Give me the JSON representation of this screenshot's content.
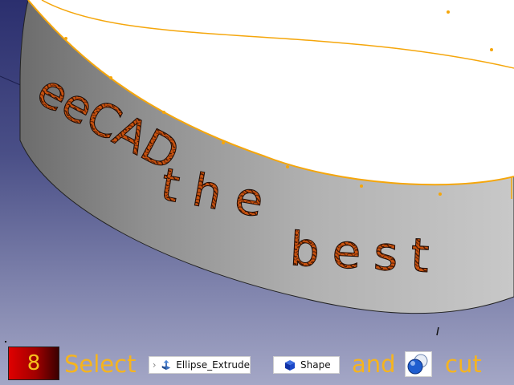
{
  "viewport": {
    "engraved_text": [
      "eeCAD",
      "the",
      "best"
    ]
  },
  "tutorial": {
    "step_number": "8",
    "select_label": "Select",
    "item1_label": "Ellipse_Extrude",
    "item2_label": "Shape",
    "and_label": "and",
    "cut_label": "cut"
  },
  "icons": {
    "item1": "extrude-icon",
    "item2": "shape-cube-icon",
    "cut_tool": "boolean-cut-icon"
  },
  "colors": {
    "highlight_edge": "#f5a60b",
    "caption_text": "#f6b41e",
    "badge_red": "#e00000"
  }
}
